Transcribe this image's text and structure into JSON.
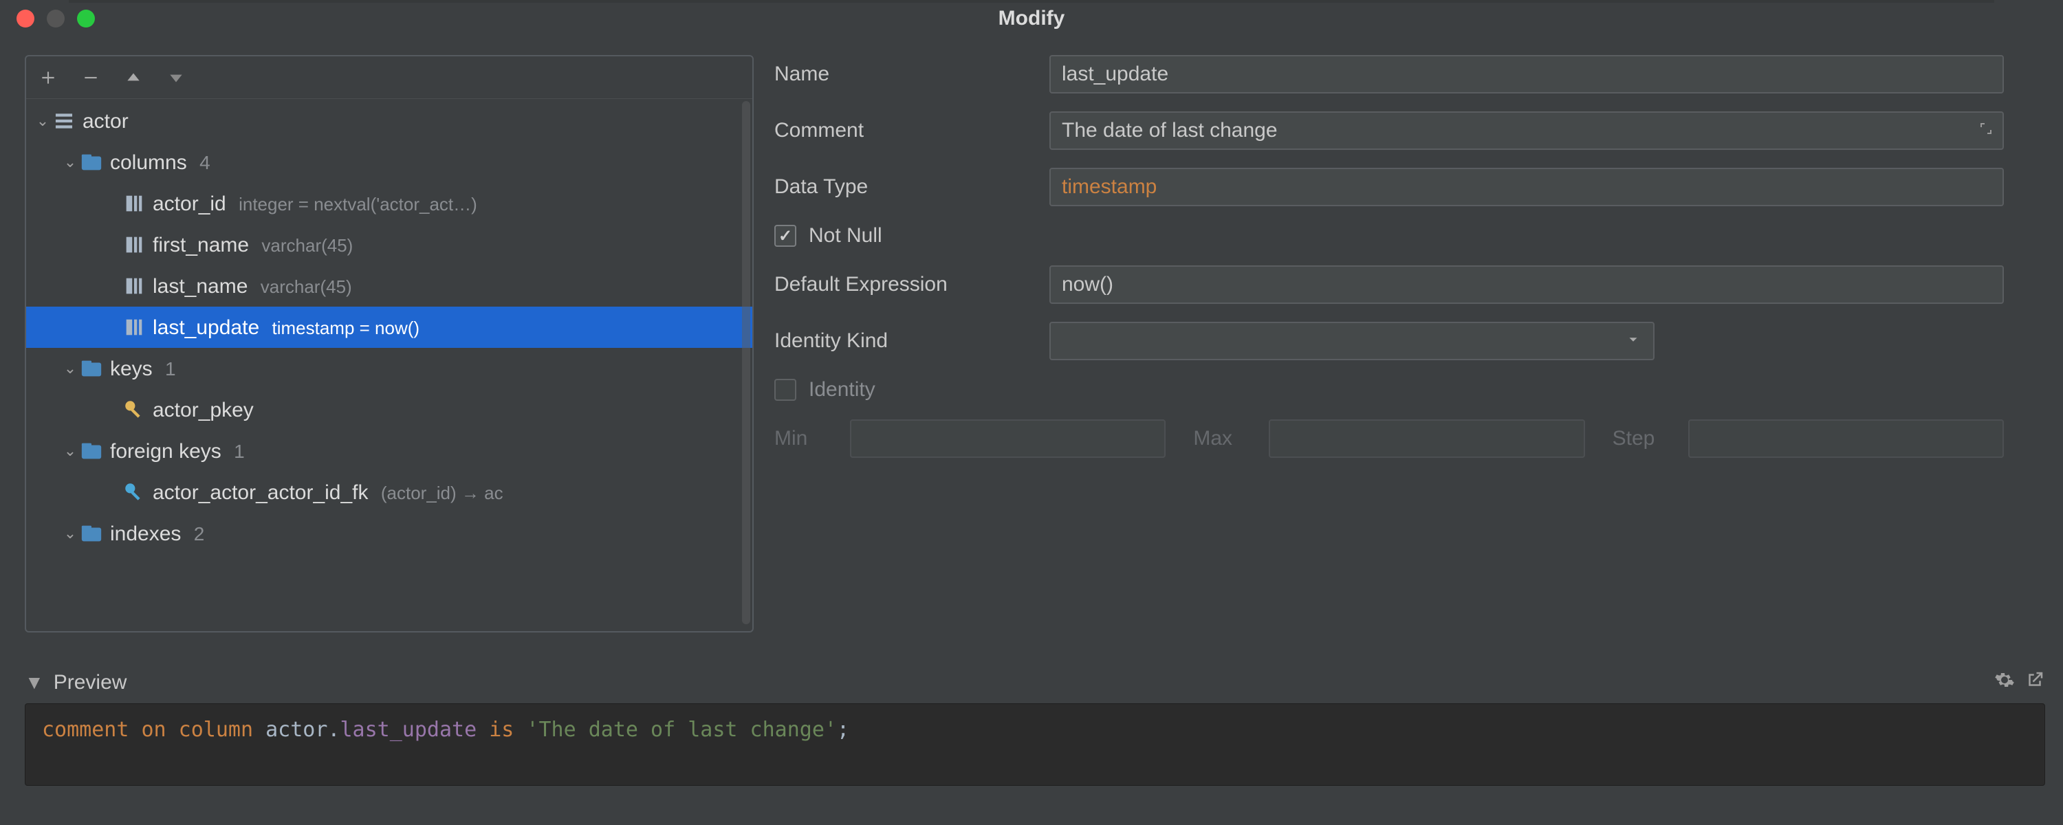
{
  "window": {
    "title": "Modify"
  },
  "toolbar": {
    "add": "+",
    "remove": "−",
    "up": "▲",
    "down": "▼"
  },
  "tree": {
    "table_name": "actor",
    "columns_label": "columns",
    "columns_count": "4",
    "columns": [
      {
        "name": "actor_id",
        "detail": "integer = nextval('actor_act…)"
      },
      {
        "name": "first_name",
        "detail": "varchar(45)"
      },
      {
        "name": "last_name",
        "detail": "varchar(45)"
      },
      {
        "name": "last_update",
        "detail": "timestamp = now()"
      }
    ],
    "selected_column_index": 3,
    "keys_label": "keys",
    "keys_count": "1",
    "keys": [
      {
        "name": "actor_pkey"
      }
    ],
    "fkeys_label": "foreign keys",
    "fkeys_count": "1",
    "fkeys": [
      {
        "name": "actor_actor_actor_id_fk",
        "detail": "(actor_id) → ac"
      }
    ],
    "indexes_label": "indexes",
    "indexes_count": "2"
  },
  "form": {
    "name_label": "Name",
    "name_value": "last_update",
    "comment_label": "Comment",
    "comment_value": "The date of last change",
    "datatype_label": "Data Type",
    "datatype_value": "timestamp",
    "notnull_label": "Not Null",
    "notnull_checked": true,
    "default_label": "Default Expression",
    "default_value": "now()",
    "identitykind_label": "Identity Kind",
    "identitykind_value": "",
    "identity_label": "Identity",
    "identity_checked": false,
    "min_label": "Min",
    "max_label": "Max",
    "step_label": "Step"
  },
  "preview": {
    "label": "Preview",
    "sql_kw1": "comment on column",
    "sql_table": "actor",
    "sql_col": "last_update",
    "sql_kw2": "is",
    "sql_str": "'The date of last change'",
    "sql_semicolon": ";"
  }
}
